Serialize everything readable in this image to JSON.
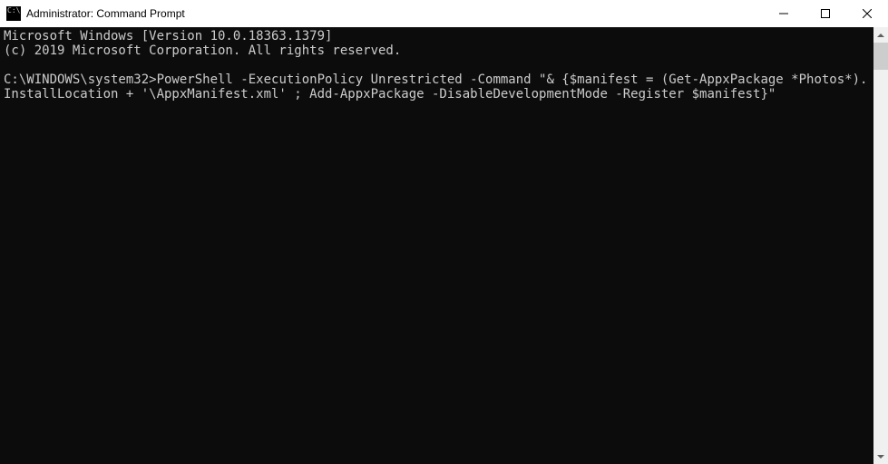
{
  "window": {
    "title": "Administrator: Command Prompt"
  },
  "terminal": {
    "line1": "Microsoft Windows [Version 10.0.18363.1379]",
    "line2": "(c) 2019 Microsoft Corporation. All rights reserved.",
    "blank": "",
    "prompt": "C:\\WINDOWS\\system32>",
    "command": "PowerShell -ExecutionPolicy Unrestricted -Command \"& {$manifest = (Get-AppxPackage *Photos*).InstallLocation + '\\AppxManifest.xml' ; Add-AppxPackage -DisableDevelopmentMode -Register $manifest}\""
  }
}
